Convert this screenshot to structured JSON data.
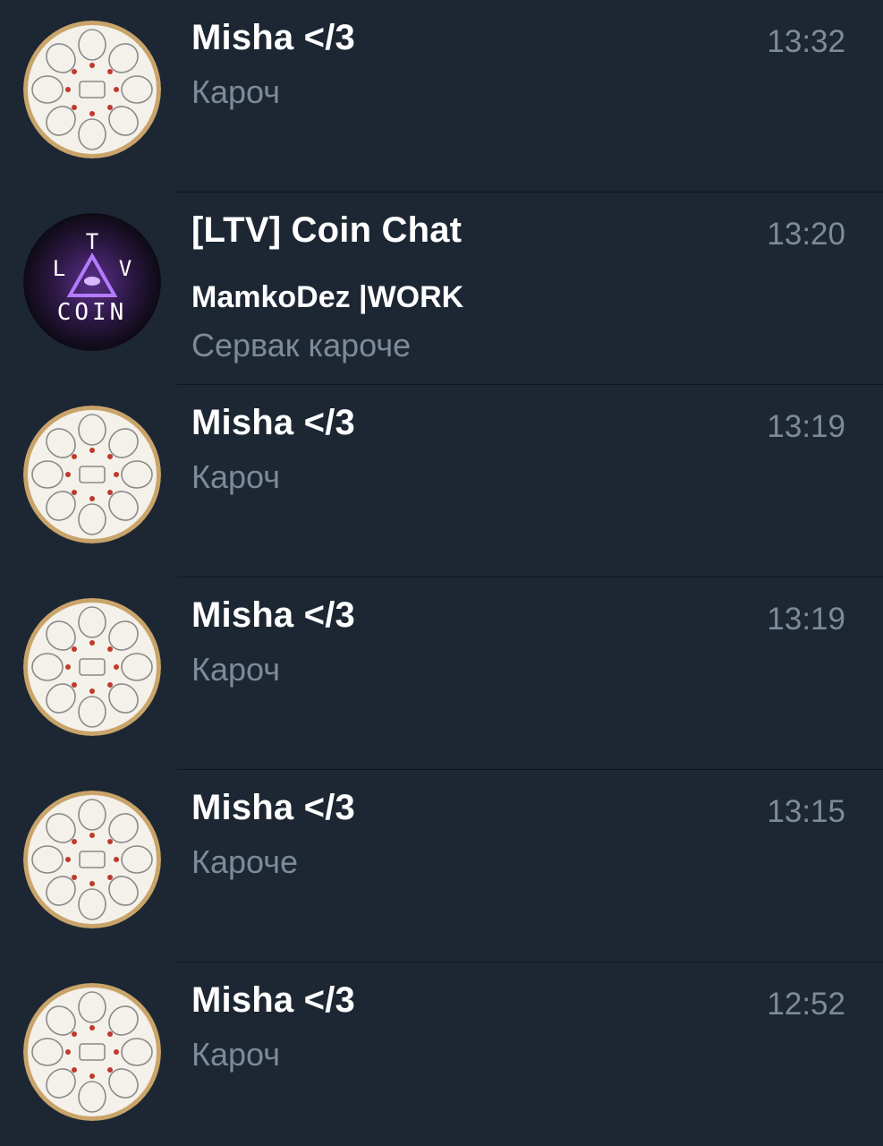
{
  "chats": [
    {
      "title": "Misha </3",
      "time": "13:32",
      "sender": "",
      "preview": "Кароч",
      "avatar_icon": "misha-avatar-icon"
    },
    {
      "title": "[LTV] Coin Chat",
      "time": "13:20",
      "sender": "MamkoDez |WORK",
      "preview": "Сервак кароче",
      "avatar_icon": "ltv-coin-logo-icon",
      "avatar_text": {
        "top": "T",
        "left": "L",
        "right": "V",
        "bottom": "COIN"
      }
    },
    {
      "title": "Misha </3",
      "time": "13:19",
      "sender": "",
      "preview": "Кароч",
      "avatar_icon": "misha-avatar-icon"
    },
    {
      "title": "Misha </3",
      "time": "13:19",
      "sender": "",
      "preview": "Кароч",
      "avatar_icon": "misha-avatar-icon"
    },
    {
      "title": "Misha </3",
      "time": "13:15",
      "sender": "",
      "preview": "Кароче",
      "avatar_icon": "misha-avatar-icon"
    },
    {
      "title": "Misha </3",
      "time": "12:52",
      "sender": "",
      "preview": "Кароч",
      "avatar_icon": "misha-avatar-icon"
    }
  ],
  "colors": {
    "background": "#1d2733",
    "divider": "#0f161e",
    "title": "#ffffff",
    "secondary_text": "#7d8b99",
    "ltv_accent": "#9b4dff"
  }
}
